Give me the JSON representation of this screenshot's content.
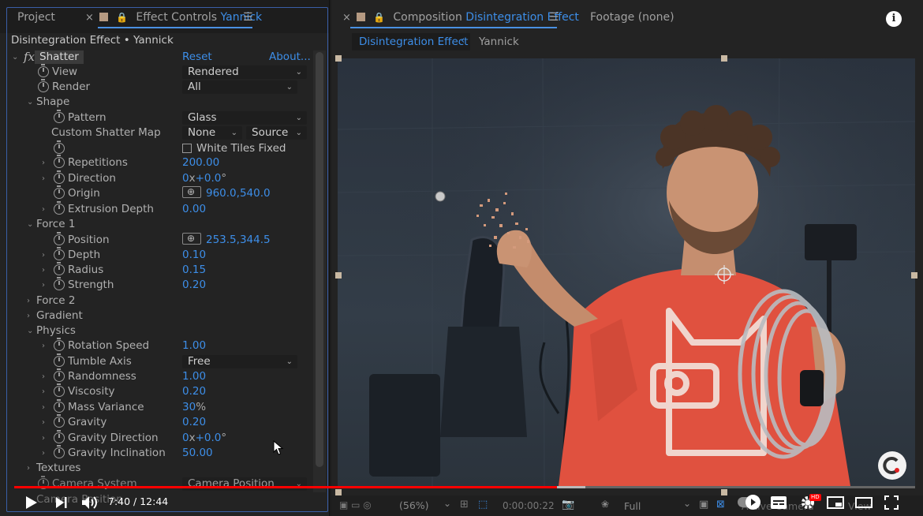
{
  "left_tabs": {
    "project": "Project",
    "effect_controls_prefix": "Effect Controls",
    "effect_controls_layer": "Yannick"
  },
  "subtitle": "Disintegration Effect • Yannick",
  "effect": {
    "fx": "fx",
    "name": "Shatter",
    "reset": "Reset",
    "about": "About..."
  },
  "rows": {
    "view": {
      "label": "View",
      "value": "Rendered"
    },
    "render": {
      "label": "Render",
      "value": "All"
    },
    "shape": {
      "label": "Shape"
    },
    "pattern": {
      "label": "Pattern",
      "value": "Glass"
    },
    "custom_map": {
      "label": "Custom Shatter Map",
      "value": "None",
      "value2": "Source"
    },
    "white_tiles": {
      "label": "White Tiles Fixed"
    },
    "repetitions": {
      "label": "Repetitions",
      "value": "200.00"
    },
    "direction": {
      "label": "Direction",
      "v1": "0",
      "x": "x",
      "v2": "+0.0",
      "deg": "°"
    },
    "origin": {
      "label": "Origin",
      "value": "960.0,540.0"
    },
    "extrusion": {
      "label": "Extrusion Depth",
      "value": "0.00"
    },
    "force1": {
      "label": "Force 1"
    },
    "position": {
      "label": "Position",
      "value": "253.5,344.5"
    },
    "depth": {
      "label": "Depth",
      "value": "0.10"
    },
    "radius": {
      "label": "Radius",
      "value": "0.15"
    },
    "strength": {
      "label": "Strength",
      "value": "0.20"
    },
    "force2": {
      "label": "Force 2"
    },
    "gradient": {
      "label": "Gradient"
    },
    "physics": {
      "label": "Physics"
    },
    "rotation_speed": {
      "label": "Rotation Speed",
      "value": "1.00"
    },
    "tumble_axis": {
      "label": "Tumble Axis",
      "value": "Free"
    },
    "randomness": {
      "label": "Randomness",
      "value": "1.00"
    },
    "viscosity": {
      "label": "Viscosity",
      "value": "0.20"
    },
    "mass_variance": {
      "label": "Mass Variance",
      "value": "30",
      "unit": "%"
    },
    "gravity": {
      "label": "Gravity",
      "value": "0.20"
    },
    "gravity_direction": {
      "label": "Gravity Direction",
      "v1": "0",
      "x": "x",
      "v2": "+0.0",
      "deg": "°"
    },
    "gravity_inclination": {
      "label": "Gravity Inclination",
      "value": "50.00"
    },
    "textures": {
      "label": "Textures"
    },
    "camera_system": {
      "label": "Camera System",
      "value": "Camera Position"
    },
    "camera_position": {
      "label": "Camera Position"
    }
  },
  "right_tabs": {
    "comp_prefix": "Composition",
    "comp_name": "Disintegration Effect",
    "footage": "Footage",
    "footage_value": "(none)",
    "sub_active": "Disintegration Effect",
    "sub_other": "Yannick"
  },
  "viewer_bar": {
    "zoom": "(56%)",
    "timecode": "0:00:00:22",
    "resolution": "Full",
    "camera": "Active Camera",
    "view": "View"
  },
  "player": {
    "time": "7:40 / 12:44",
    "progress_fraction": 0.6021,
    "hd_badge": "HD"
  },
  "colors": {
    "accent_blue": "#3d8ee8",
    "panel": "#232323",
    "yt_red": "#ff0000",
    "shirt_red": "#e0513f"
  }
}
